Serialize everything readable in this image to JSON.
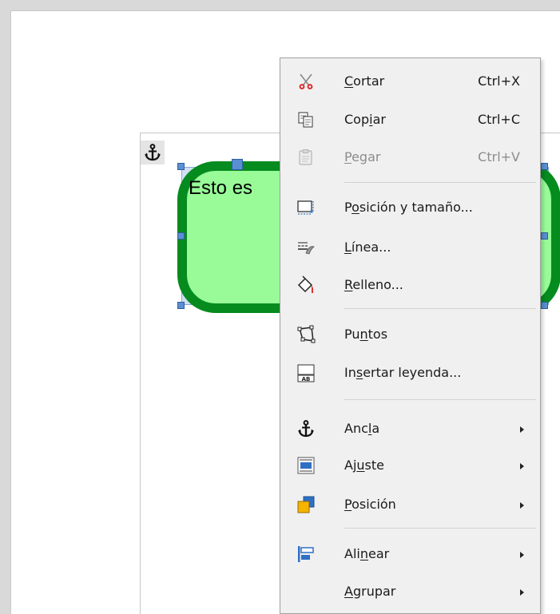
{
  "document": {
    "shape_text": "Esto es",
    "shape_fill": "#98fb98",
    "shape_border": "#068b1f",
    "selection_color": "#5a8fd4"
  },
  "context_menu": {
    "items": [
      {
        "label": "Cortar",
        "mnemonic": "C",
        "shortcut": "Ctrl+X",
        "icon": "scissors-icon",
        "enabled": true
      },
      {
        "label": "Copiar",
        "mnemonic": "i",
        "shortcut": "Ctrl+C",
        "icon": "copy-icon",
        "enabled": true
      },
      {
        "label": "Pegar",
        "mnemonic": "P",
        "shortcut": "Ctrl+V",
        "icon": "paste-icon",
        "enabled": false
      },
      {
        "label": "Posición y tamaño...",
        "mnemonic": "o",
        "icon": "position-size-icon",
        "enabled": true
      },
      {
        "label": "Línea...",
        "mnemonic": "L",
        "icon": "line-icon",
        "enabled": true
      },
      {
        "label": "Relleno...",
        "mnemonic": "R",
        "icon": "fill-bucket-icon",
        "enabled": true
      },
      {
        "label": "Puntos",
        "mnemonic": "n",
        "icon": "points-icon",
        "enabled": true
      },
      {
        "label": "Insertar leyenda...",
        "mnemonic": "s",
        "icon": "insert-caption-icon",
        "enabled": true
      },
      {
        "label": "Ancla",
        "mnemonic": "l",
        "icon": "anchor-icon",
        "submenu": true,
        "enabled": true
      },
      {
        "label": "Ajuste",
        "mnemonic": "u",
        "icon": "wrap-icon",
        "submenu": true,
        "enabled": true
      },
      {
        "label": "Posición",
        "mnemonic": "P",
        "icon": "arrange-icon",
        "submenu": true,
        "enabled": true
      },
      {
        "label": "Alinear",
        "mnemonic": "n",
        "icon": "align-icon",
        "submenu": true,
        "enabled": true
      },
      {
        "label": "Agrupar",
        "mnemonic": "A",
        "submenu": true,
        "enabled": true
      }
    ]
  }
}
